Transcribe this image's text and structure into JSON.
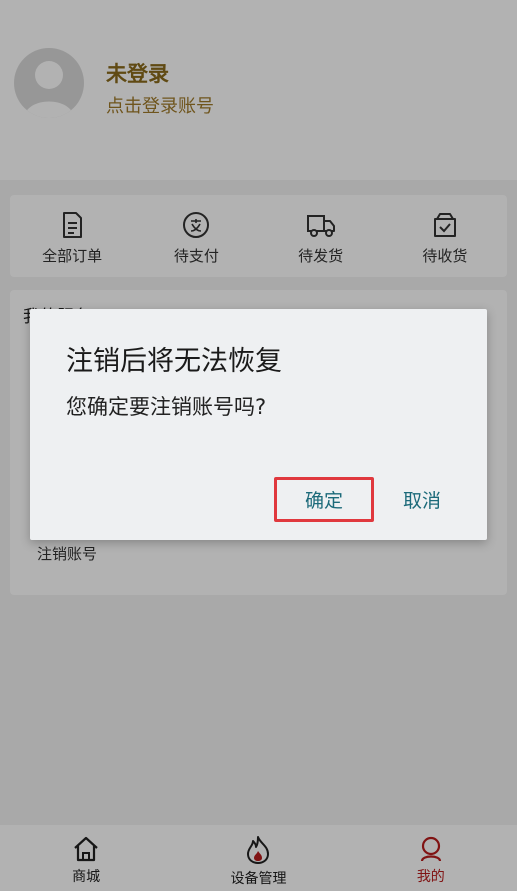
{
  "profile": {
    "name": "未登录",
    "login_hint": "点击登录账号"
  },
  "orders": {
    "items": [
      {
        "label": "全部订单",
        "icon": "document-icon"
      },
      {
        "label": "待支付",
        "icon": "payment-icon"
      },
      {
        "label": "待发货",
        "icon": "truck-icon"
      },
      {
        "label": "待收货",
        "icon": "box-check-icon"
      }
    ]
  },
  "account": {
    "title": "我的服务",
    "delete_label": "注销账号"
  },
  "bottom_nav": {
    "items": [
      {
        "label": "商城",
        "icon": "home-icon"
      },
      {
        "label": "设备管理",
        "icon": "flame-icon"
      },
      {
        "label": "我的",
        "icon": "user-icon",
        "active": true
      }
    ]
  },
  "dialog": {
    "title": "注销后将无法恢复",
    "message": "您确定要注销账号吗?",
    "confirm_label": "确定",
    "cancel_label": "取消"
  },
  "colors": {
    "accent": "#b81c1c",
    "button_text": "#1c6a7a",
    "highlight_border": "#e0383e",
    "name_gold": "#8a6a1c"
  }
}
